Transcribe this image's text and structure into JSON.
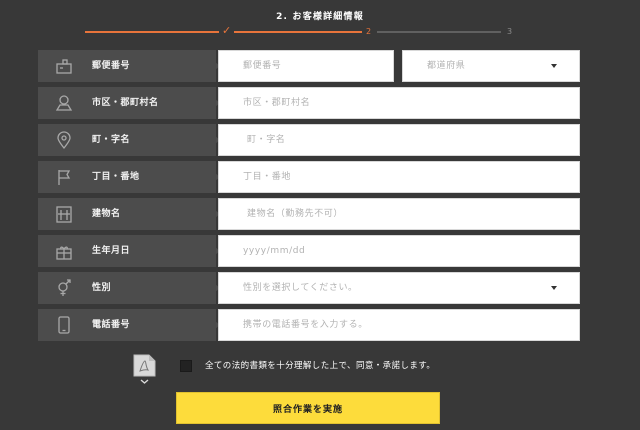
{
  "header": {
    "step_title": "2. お客様詳細情報",
    "steps": [
      {
        "mark": "✓",
        "state": "done"
      },
      {
        "mark": "2",
        "state": "current"
      },
      {
        "mark": "3",
        "state": "todo"
      }
    ],
    "accent_color": "#e8743b"
  },
  "form": {
    "rows": [
      {
        "label": "郵便番号",
        "icon": "postbox-icon",
        "fields": [
          {
            "placeholder": "郵便番号"
          },
          {
            "placeholder": "都道府県",
            "type": "select"
          }
        ]
      },
      {
        "label": "市区・郡町村名",
        "icon": "map-pin-area-icon",
        "fields": [
          {
            "placeholder": "市区・郡町村名"
          }
        ]
      },
      {
        "label": "町・字名",
        "icon": "location-pin-icon",
        "fields": [
          {
            "placeholder": "町・字名"
          }
        ]
      },
      {
        "label": "丁目・番地",
        "icon": "flag-icon",
        "fields": [
          {
            "placeholder": "丁目・番地"
          }
        ]
      },
      {
        "label": "建物名",
        "icon": "building-icon",
        "fields": [
          {
            "placeholder": "建物名（勤務先不可）"
          }
        ]
      },
      {
        "label": "生年月日",
        "icon": "gift-icon",
        "fields": [
          {
            "placeholder": "yyyy/mm/dd"
          }
        ]
      },
      {
        "label": "性別",
        "icon": "gender-icon",
        "fields": [
          {
            "placeholder": "性別を選択してください。",
            "type": "select"
          }
        ]
      },
      {
        "label": "電話番号",
        "icon": "smartphone-icon",
        "fields": [
          {
            "placeholder": "携帯の電話番号を入力する。"
          }
        ]
      }
    ]
  },
  "consent": {
    "pdf_icon": "pdf-document-icon",
    "checked": false,
    "text": "全ての法的書類を十分理解した上で、同意・承諾します。"
  },
  "submit": {
    "label": "照合作業を実施",
    "color": "#fddc3b"
  }
}
